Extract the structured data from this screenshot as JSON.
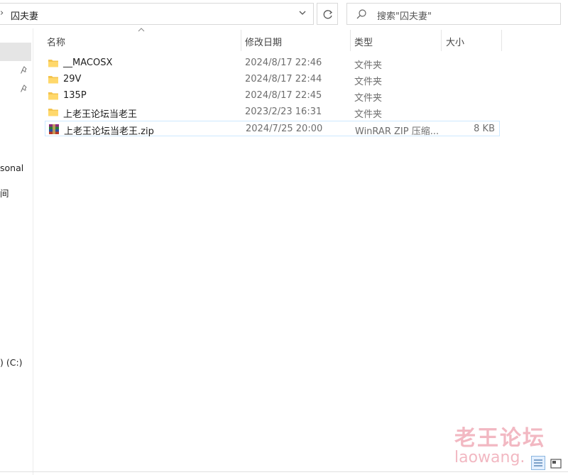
{
  "address": {
    "current_folder": "囚夫妻"
  },
  "search": {
    "placeholder": "搜索\"囚夫妻\""
  },
  "nav": {
    "items": [
      {
        "label": "sonal"
      },
      {
        "label": "间"
      },
      {
        "label": ") (C:)"
      }
    ]
  },
  "columns": {
    "name": "名称",
    "date": "修改日期",
    "type": "类型",
    "size": "大小"
  },
  "files": [
    {
      "name": "__MACOSX",
      "date": "2024/8/17 22:46",
      "type": "文件夹",
      "size": "",
      "icon": "folder-icon"
    },
    {
      "name": "29V",
      "date": "2024/8/17 22:44",
      "type": "文件夹",
      "size": "",
      "icon": "folder-icon"
    },
    {
      "name": "135P",
      "date": "2024/8/17 22:45",
      "type": "文件夹",
      "size": "",
      "icon": "folder-icon"
    },
    {
      "name": "上老王论坛当老王",
      "date": "2023/2/23 16:31",
      "type": "文件夹",
      "size": "",
      "icon": "folder-icon"
    },
    {
      "name": "上老王论坛当老王.zip",
      "date": "2024/7/25 20:00",
      "type": "WinRAR ZIP 压缩...",
      "size": "8 KB",
      "icon": "winrar-archive-icon"
    }
  ],
  "watermark": {
    "cn": "老王论坛",
    "en": "laowang."
  },
  "colors": {
    "folder": "#f4c44e",
    "selection_border": "#cde8ff",
    "watermark": "#f2b8c2"
  }
}
